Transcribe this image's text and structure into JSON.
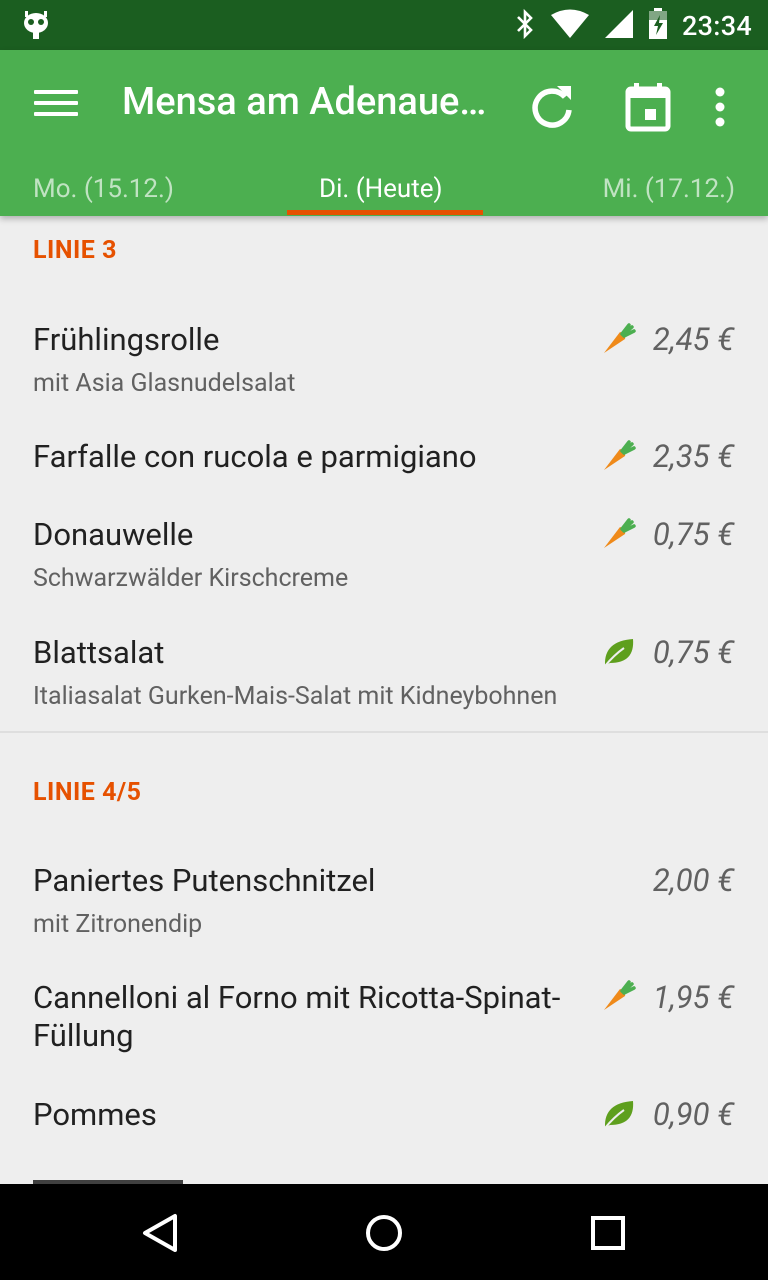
{
  "status_bar": {
    "time": "23:34",
    "icons": [
      "android-debug-icon",
      "bluetooth-icon",
      "wifi-icon",
      "signal-icon",
      "battery-icon"
    ]
  },
  "app_bar": {
    "title": "Mensa am Adenauerring",
    "actions": [
      "refresh-icon",
      "calendar-icon",
      "overflow-menu-icon"
    ],
    "background_color": "#4caf50",
    "status_bar_color": "#1b5e20"
  },
  "tabs": [
    {
      "label": "Mo. (15.12.)",
      "active": false
    },
    {
      "label": "Di. (Heute)",
      "active": true
    },
    {
      "label": "Mi. (17.12.)",
      "active": false
    }
  ],
  "accent_color": "#e65100",
  "sections": [
    {
      "title": "LINIE 3",
      "meals": [
        {
          "name": "Frühlingsrolle",
          "description": "mit Asia Glasnudelsalat",
          "price": "2,45 €",
          "icon": "carrot-icon"
        },
        {
          "name": "Farfalle con rucola e parmigiano",
          "description": "",
          "price": "2,35 €",
          "icon": "carrot-icon"
        },
        {
          "name": "Donauwelle",
          "description": "Schwarzwälder Kirschcreme",
          "price": "0,75 €",
          "icon": "carrot-icon"
        },
        {
          "name": "Blattsalat",
          "description": "Italiasalat Gurken-Mais-Salat mit Kidneybohnen",
          "price": "0,75 €",
          "icon": "leaf-icon"
        }
      ]
    },
    {
      "title": "LINIE 4/5",
      "meals": [
        {
          "name": "Paniertes Putenschnitzel",
          "description": "mit Zitronendip",
          "price": "2,00 €",
          "icon": ""
        },
        {
          "name": "Cannelloni al Forno mit Ricotta-Spinat-Füllung",
          "description": "",
          "price": "1,95 €",
          "icon": "carrot-icon"
        },
        {
          "name": "Pommes",
          "description": "",
          "price": "0,90 €",
          "icon": "leaf-icon"
        }
      ]
    }
  ],
  "nav_bar": [
    "back-icon",
    "home-icon",
    "recents-icon"
  ]
}
